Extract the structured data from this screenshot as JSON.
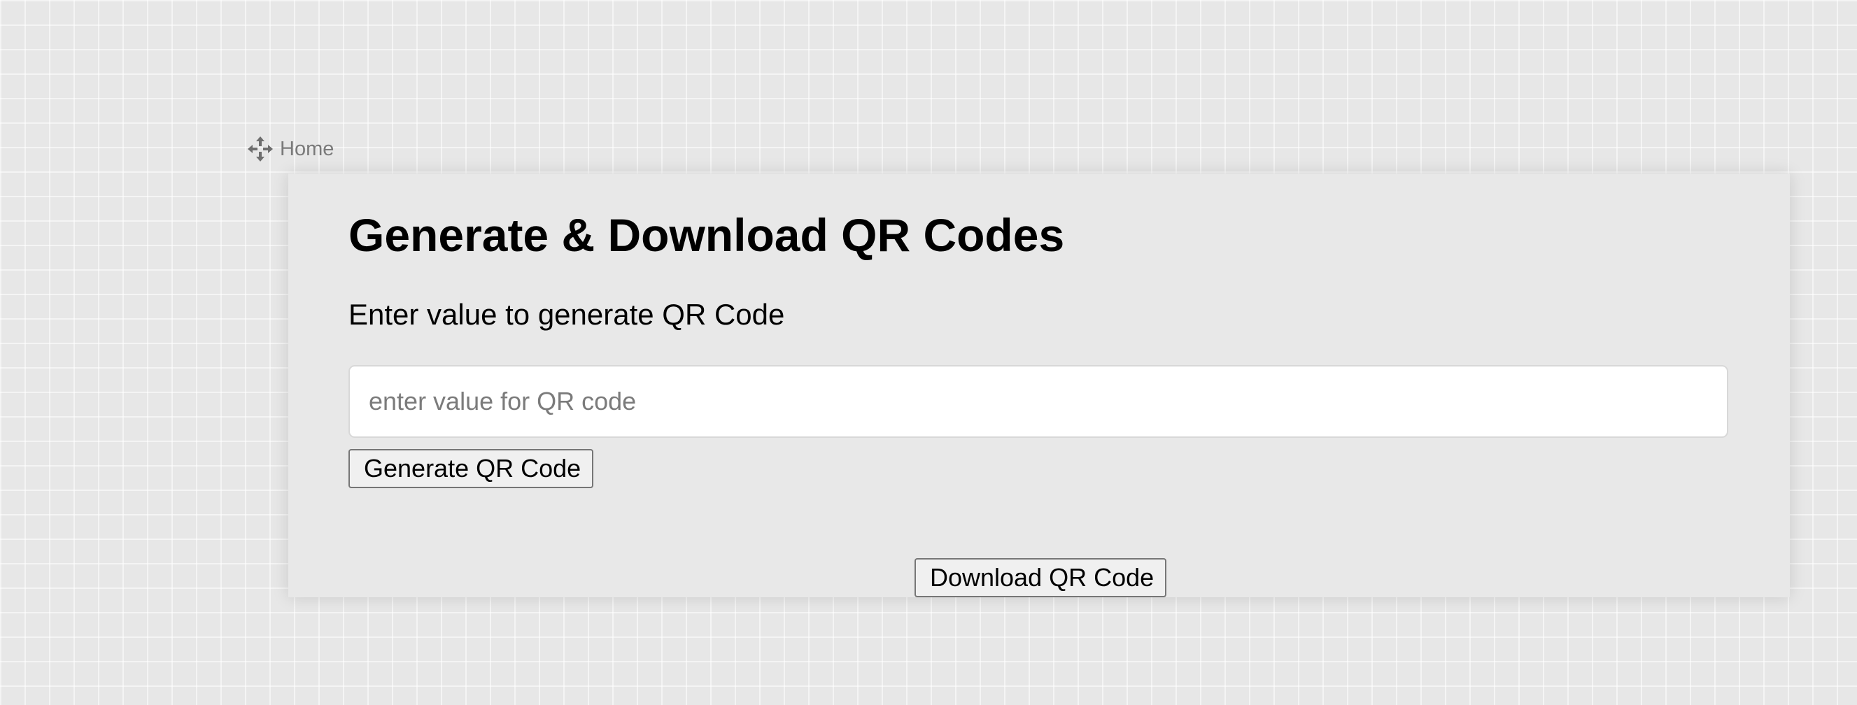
{
  "nav": {
    "home_label": "Home",
    "home_icon": "move-arrows-icon"
  },
  "main": {
    "title": "Generate & Download QR Codes",
    "subtitle": "Enter value to generate QR Code",
    "input": {
      "value": "",
      "placeholder": "enter value for QR code"
    },
    "generate_label": "Generate QR Code",
    "download_label": "Download QR Code"
  },
  "colors": {
    "background": "#e7e7e7",
    "card": "#e8e8e8",
    "muted_text": "#7a7a7a"
  }
}
